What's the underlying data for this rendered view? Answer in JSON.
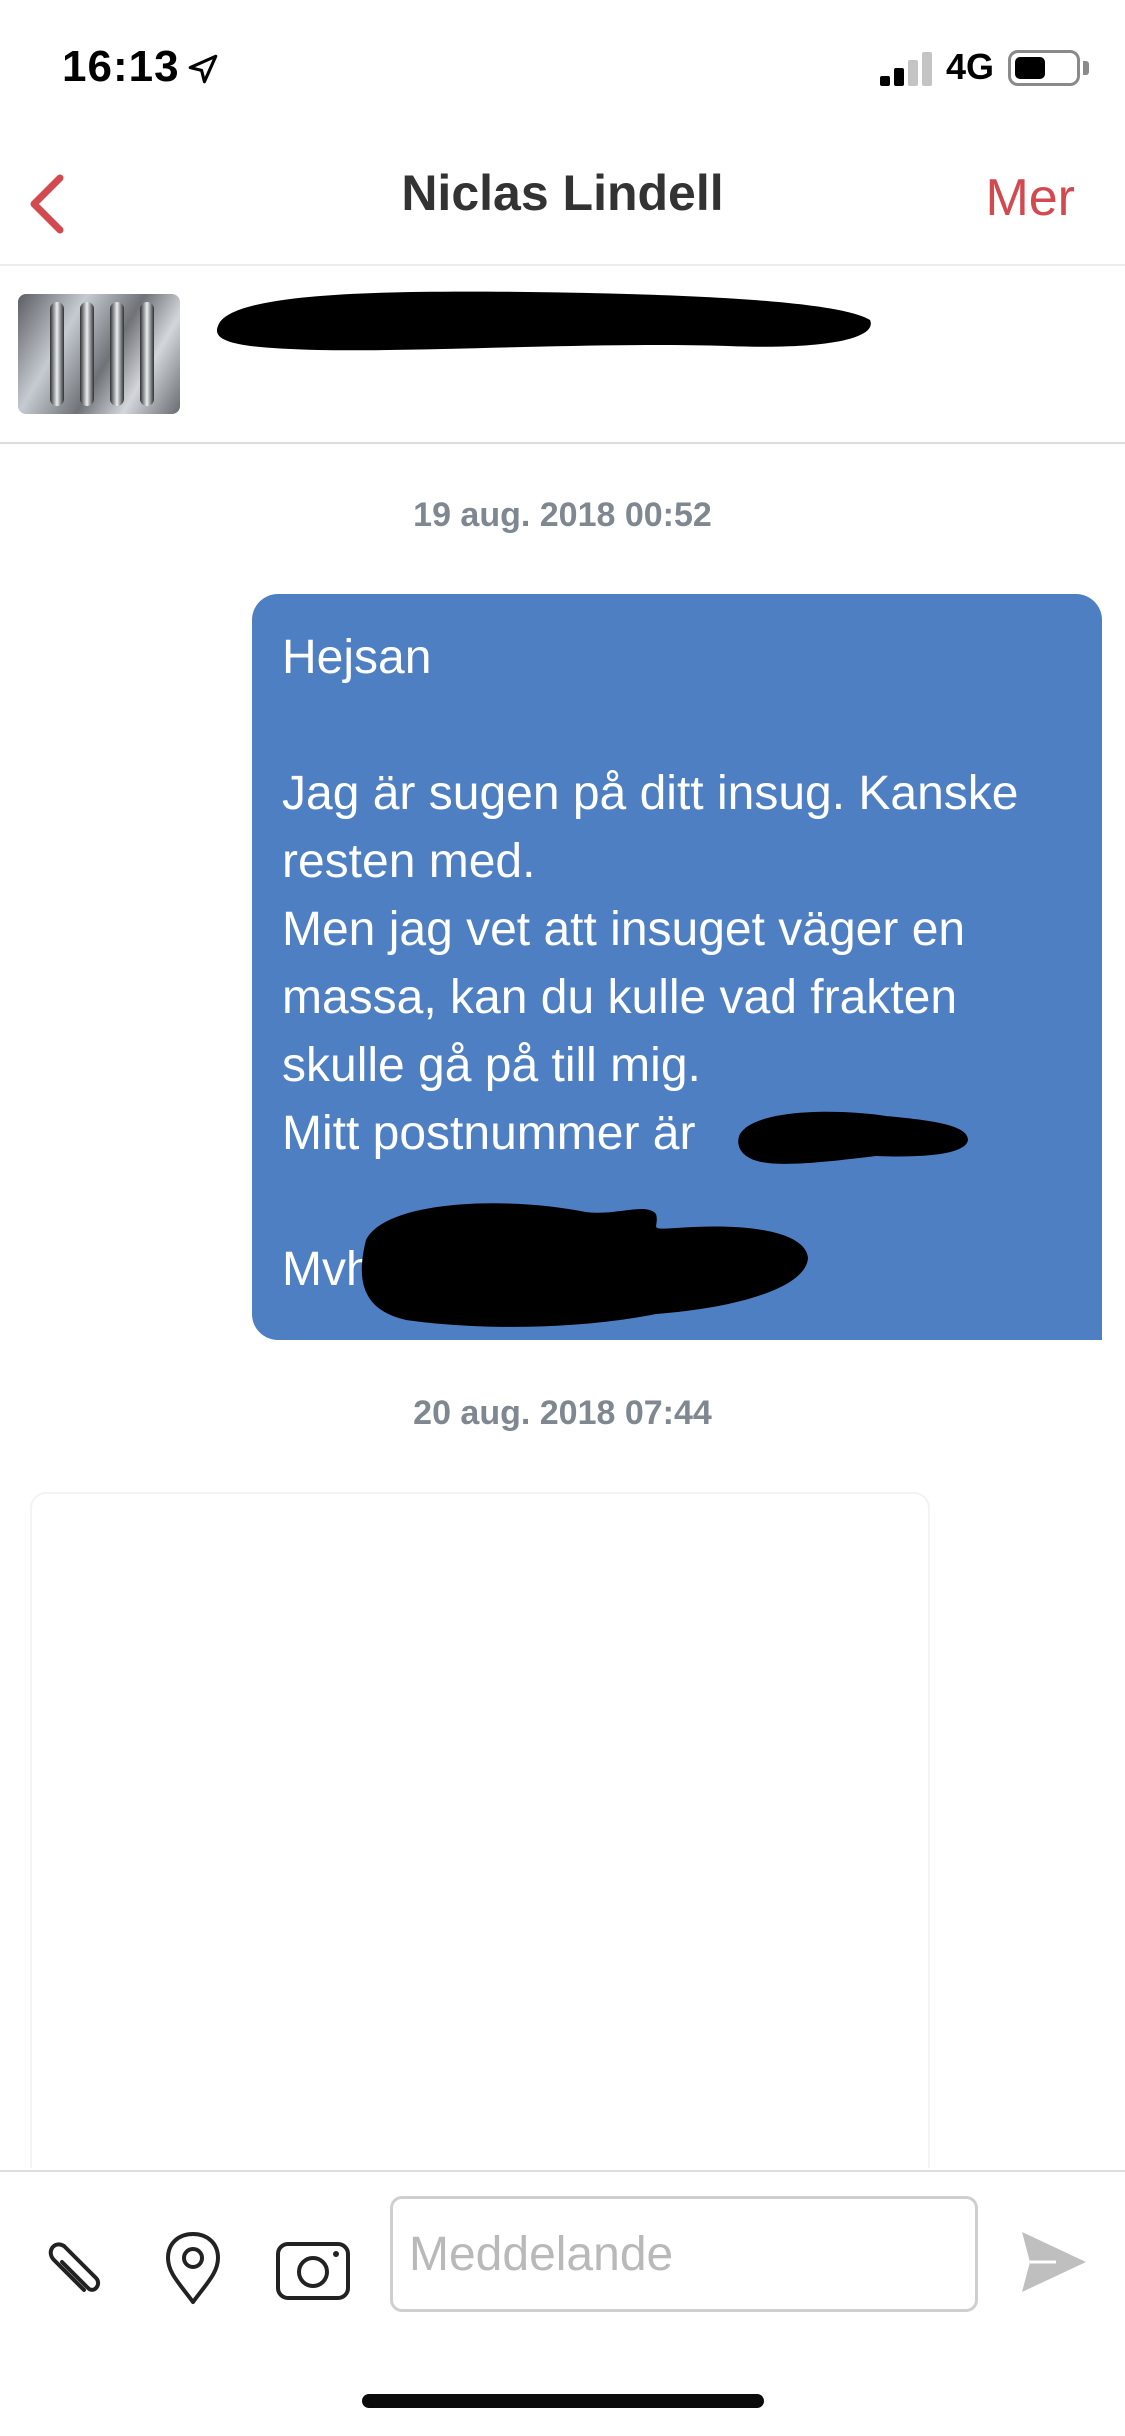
{
  "status_bar": {
    "time": "16:13",
    "network": "4G",
    "signal_bars_active": 2,
    "signal_bars_total": 4,
    "battery_level": 0.5
  },
  "nav": {
    "title": "Niclas Lindell",
    "more_label": "Mer",
    "accent_color": "#d24a50"
  },
  "listing": {
    "title_redacted": true
  },
  "messages": [
    {
      "timestamp": "19 aug. 2018 00:52",
      "direction": "sent",
      "text": "Hejsan\n\nJag är sugen på ditt insug. Kanske resten med.\nMen jag vet att insuget väger en massa, kan du kulle vad frakten skulle gå på till mig.\nMitt postnummer är \n\nMvh",
      "bubble_color": "#4e7fc2"
    },
    {
      "timestamp": "20 aug. 2018 07:44",
      "direction": "received",
      "text": ""
    }
  ],
  "composer": {
    "placeholder": "Meddelande",
    "icons": [
      "paperclip-icon",
      "location-pin-icon",
      "camera-icon",
      "send-icon"
    ]
  }
}
